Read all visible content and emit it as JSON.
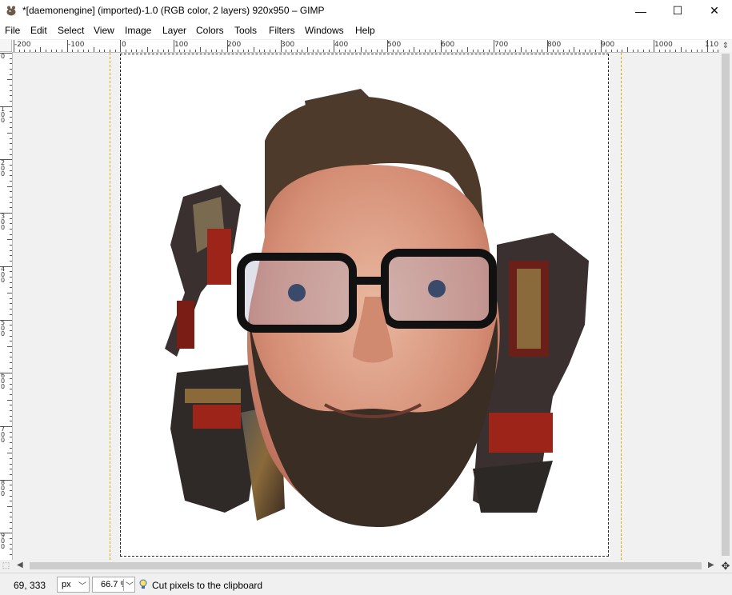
{
  "window": {
    "title": "*[daemonengine] (imported)-1.0 (RGB color, 2 layers) 920x950 – GIMP",
    "minimize": "—",
    "maximize": "☐",
    "close": "✕"
  },
  "menu": [
    "File",
    "Edit",
    "Select",
    "View",
    "Image",
    "Layer",
    "Colors",
    "Tools",
    "Filters",
    "Windows",
    "Help"
  ],
  "ruler": {
    "horizontal": [
      "-200",
      "-100",
      "0",
      "100",
      "200",
      "300",
      "400",
      "500",
      "600",
      "700",
      "800",
      "900",
      "1000",
      "110"
    ],
    "vertical": [
      "0",
      "100",
      "200",
      "300",
      "400",
      "500",
      "600",
      "700",
      "800",
      "900"
    ]
  },
  "canvas": {
    "image_description_icon": "photo-composite",
    "background_color": "#ffffff",
    "guide_color": "#d4b300"
  },
  "status": {
    "coordinates": "69, 333",
    "unit": "px",
    "zoom": "66.7 %",
    "message": "Cut pixels to the clipboard"
  }
}
